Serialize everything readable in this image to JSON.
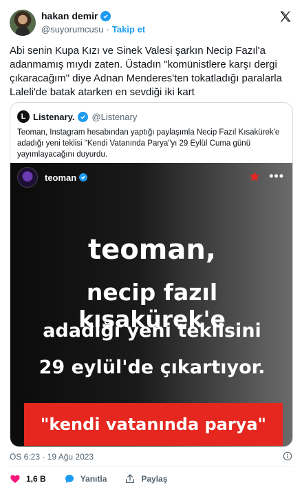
{
  "author": {
    "display_name": "hakan demir",
    "handle": "@suyorumcusu",
    "separator": "·",
    "follow_label": "Takip et"
  },
  "tweet": {
    "text": "Abi senin Kupa Kızı ve Sinek Valesi şarkın Necip Fazıl'a adanmamış mıydı zaten. Üstadın \"komünistlere karşı dergi çıkaracağım\" diye Adnan Menderes'ten tokatladığı paralarla Laleli'de batak atarken en sevdiği iki kart",
    "timestamp": "ÖS 6:23 · 19 Ağu 2023"
  },
  "quote": {
    "avatar_letter": "L",
    "display_name": "Listenary.",
    "handle": "@Listenary",
    "text": "Teoman, Instagram hesabından yaptığı paylaşımla Necip Fazıl Kısakürek'e adadığı yeni teklisi \"Kendi Vatanında Parya\"yı 29 Eylül Cuma günü yayımlayacağını duyurdu.",
    "image": {
      "account_name": "teoman",
      "more": "•••",
      "line1": "teoman,",
      "line2": "necip fazıl kısakürek'e",
      "line3": "adadığı yeni teklisini",
      "line4": "29 eylül'de çıkartıyor.",
      "banner": "\"kendi vatanında parya\""
    }
  },
  "actions": {
    "like_count": "1,6 B",
    "reply_label": "Yanıtla",
    "share_label": "Paylaş"
  },
  "colors": {
    "accent": "#1d9bf0",
    "like": "#f91880",
    "banner_red": "#e5271f"
  },
  "icons": [
    "verified-badge-icon",
    "x-logo-icon",
    "star-icon",
    "more-icon",
    "info-icon",
    "heart-icon",
    "reply-icon",
    "share-icon"
  ]
}
